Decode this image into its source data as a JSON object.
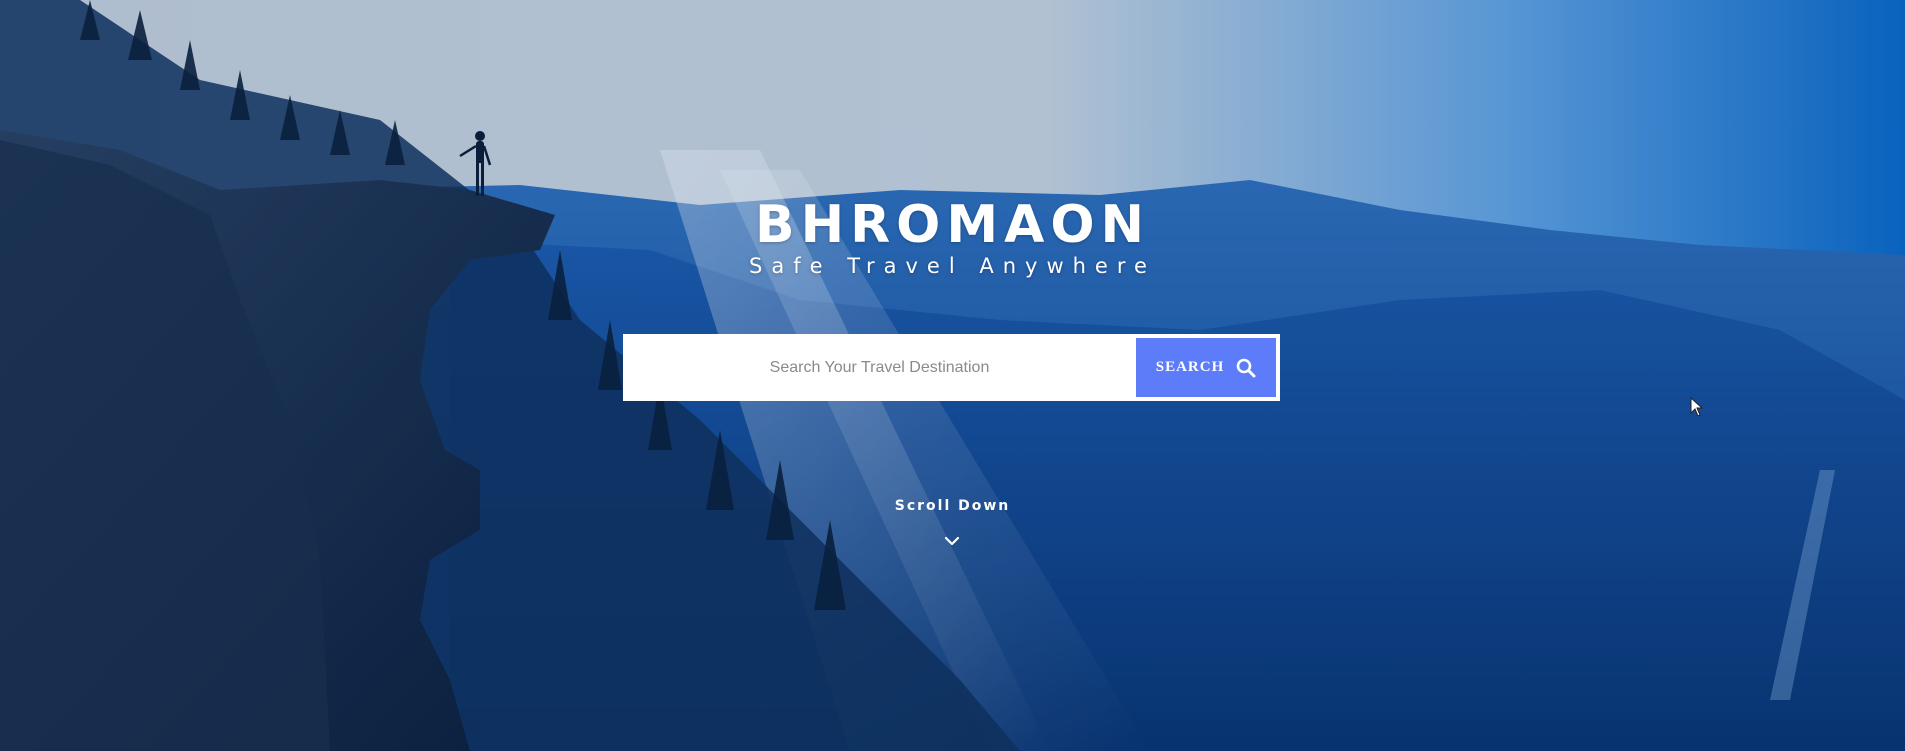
{
  "brand": {
    "title": "BHROMAON",
    "tagline": "Safe Travel Anywhere"
  },
  "search": {
    "placeholder": "Search Your Travel Destination",
    "value": "",
    "button_label": "SEARCH",
    "button_icon": "search-icon"
  },
  "scroll": {
    "label": "Scroll Down",
    "icon": "chevron-down-icon"
  },
  "colors": {
    "accent": "#5c7cfa",
    "text": "#ffffff"
  }
}
